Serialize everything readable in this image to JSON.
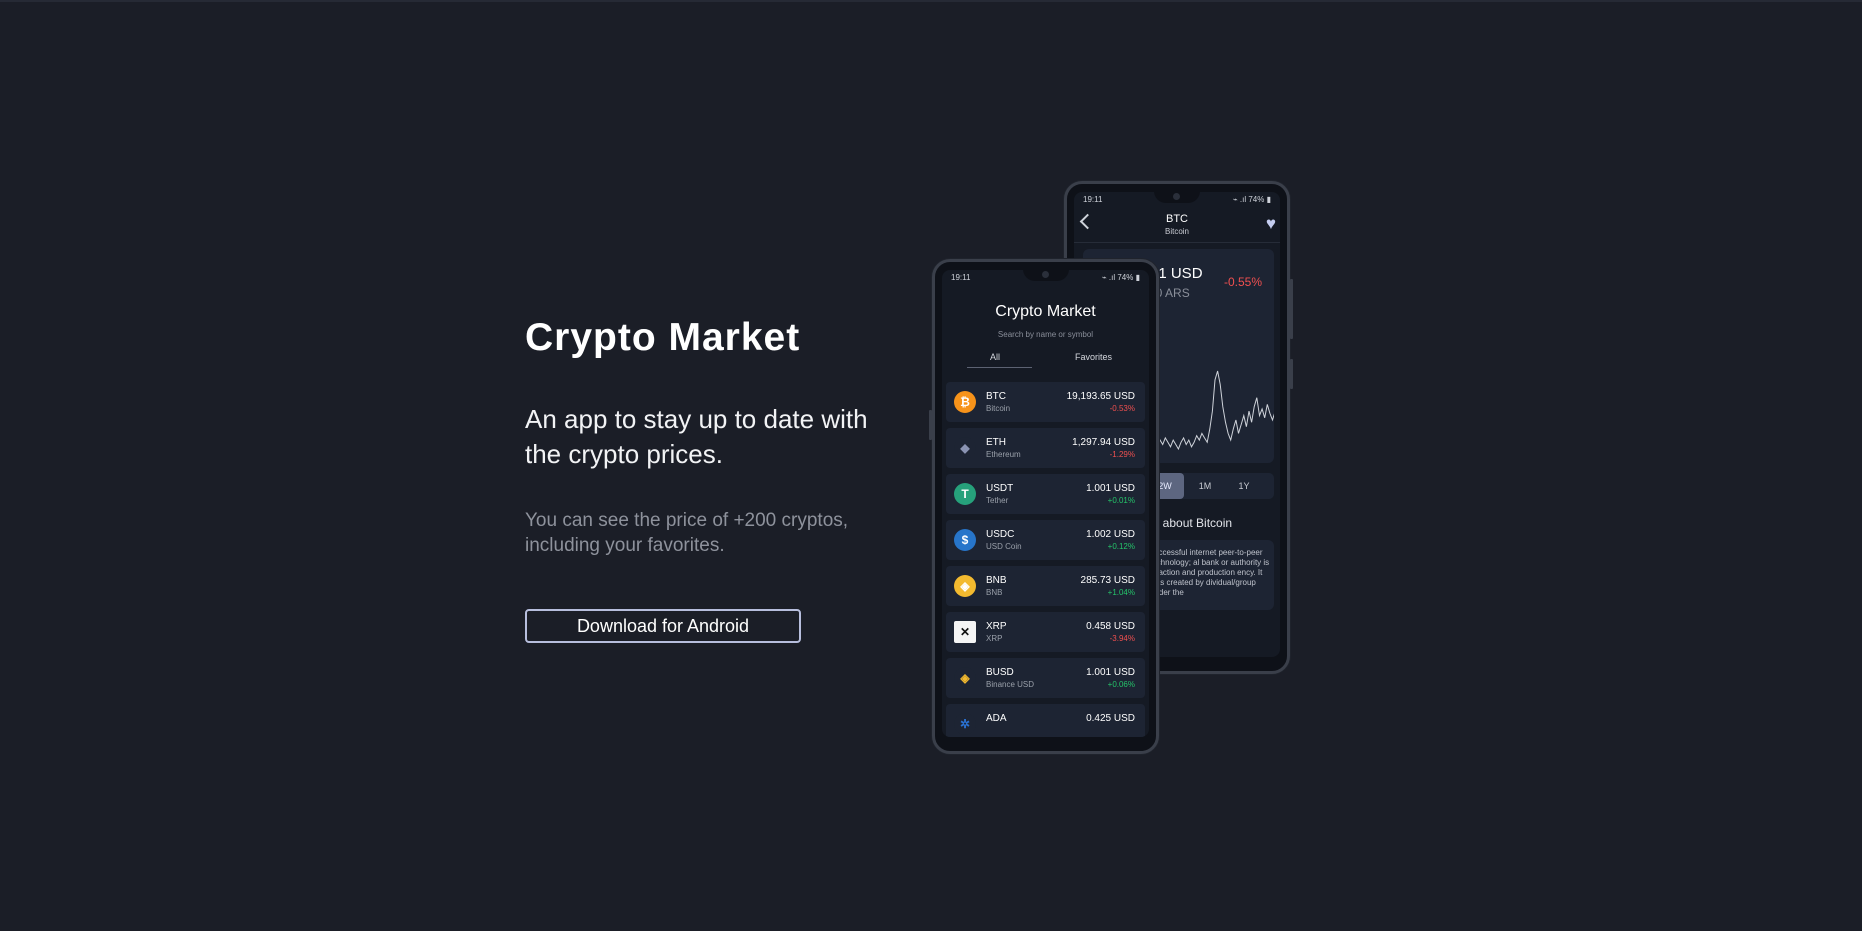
{
  "hero": {
    "title": "Crypto Market",
    "subtitle": "An app to stay up to date with the crypto prices.",
    "description": "You can see the price of +200 cryptos, including your favorites.",
    "download_label": "Download for Android"
  },
  "status": {
    "time": "19:11",
    "battery": "74%"
  },
  "detail": {
    "symbol": "BTC",
    "name": "Bitcoin",
    "price_usd": "31 USD",
    "price_ars": "00 ARS",
    "change": "-0.55%",
    "ranges": [
      "2W",
      "1M",
      "1Y"
    ],
    "active_range": "2W",
    "learn_more": "ore about Bitcoin",
    "about_text": "successful internet peer-to-peer technology; al bank or authority is nsaction and production ency. It was created by dividual/group under the"
  },
  "list": {
    "title": "Crypto Market",
    "search_placeholder": "Search by name or symbol",
    "tabs": {
      "all": "All",
      "favorites": "Favorites"
    },
    "coins": [
      {
        "symbol": "BTC",
        "name": "Bitcoin",
        "price": "19,193.65 USD",
        "change": "-0.53%",
        "direction": "neg",
        "color": "#f7931a",
        "glyph": "₿",
        "icon": "bitcoin-icon"
      },
      {
        "symbol": "ETH",
        "name": "Ethereum",
        "price": "1,297.94 USD",
        "change": "-1.29%",
        "direction": "neg",
        "color": "#1d2433",
        "glyph": "◆",
        "icon": "ethereum-icon"
      },
      {
        "symbol": "USDT",
        "name": "Tether",
        "price": "1.001 USD",
        "change": "+0.01%",
        "direction": "pos",
        "color": "#26a17b",
        "glyph": "T",
        "icon": "tether-icon"
      },
      {
        "symbol": "USDC",
        "name": "USD Coin",
        "price": "1.002 USD",
        "change": "+0.12%",
        "direction": "pos",
        "color": "#2775ca",
        "glyph": "$",
        "icon": "usd-coin-icon"
      },
      {
        "symbol": "BNB",
        "name": "BNB",
        "price": "285.73 USD",
        "change": "+1.04%",
        "direction": "pos",
        "color": "#f3ba2f",
        "glyph": "◈",
        "icon": "bnb-icon"
      },
      {
        "symbol": "XRP",
        "name": "XRP",
        "price": "0.458 USD",
        "change": "-3.94%",
        "direction": "neg",
        "color": "#f5f5f5",
        "glyph": "✕",
        "icon": "xrp-icon"
      },
      {
        "symbol": "BUSD",
        "name": "Binance USD",
        "price": "1.001 USD",
        "change": "+0.06%",
        "direction": "pos",
        "color": "#1d2433",
        "glyph": "◈",
        "icon": "busd-icon"
      },
      {
        "symbol": "ADA",
        "name": "",
        "price": "0.425 USD",
        "change": "",
        "direction": "neg",
        "color": "#1d2433",
        "glyph": "✲",
        "icon": "cardano-icon"
      }
    ]
  },
  "chart_data": {
    "type": "line",
    "values": [
      44,
      45,
      43,
      46,
      44,
      47,
      45,
      48,
      46,
      44,
      47,
      45,
      43,
      46,
      48,
      45,
      47,
      44,
      46,
      49,
      47,
      50,
      48,
      46,
      52,
      60,
      74,
      78,
      72,
      62,
      55,
      50,
      47,
      52,
      56,
      50,
      54,
      58,
      53,
      60,
      55,
      62,
      66,
      58,
      61,
      57,
      63,
      59,
      56,
      60,
      58,
      55,
      57
    ],
    "title": "",
    "xlabel": "",
    "ylabel": ""
  }
}
